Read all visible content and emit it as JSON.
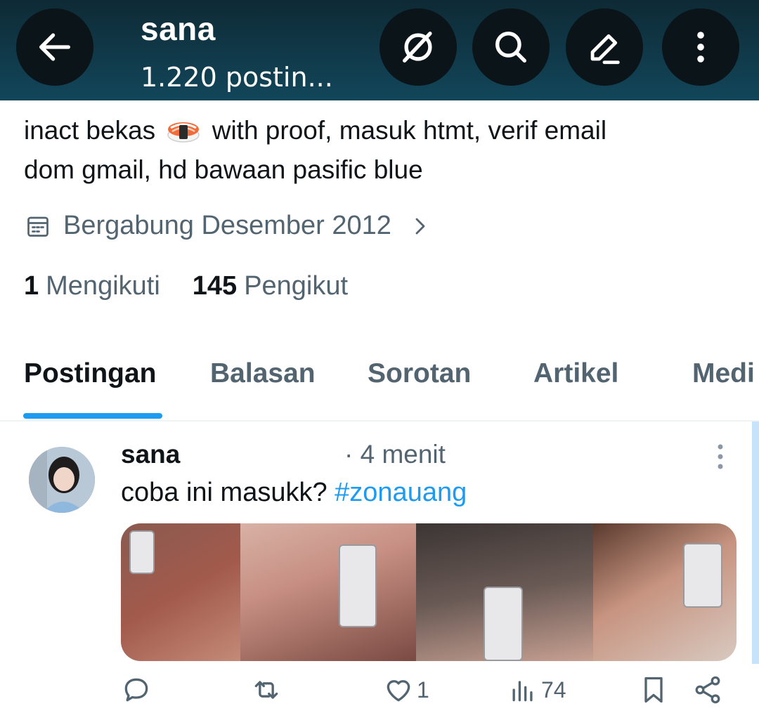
{
  "header": {
    "name": "sana",
    "post_count": "1.220 postin..."
  },
  "bio": {
    "line1_before": "inact bekas",
    "line1_after": "with proof, masuk htmt, verif email",
    "line2": "dom gmail, hd bawaan pasific blue"
  },
  "joined": "Bergabung Desember 2012",
  "follow": {
    "following_count": "1",
    "following_label": "Mengikuti",
    "followers_count": "145",
    "followers_label": "Pengikut"
  },
  "tabs": [
    {
      "label": "Postingan",
      "active": true
    },
    {
      "label": "Balasan",
      "active": false
    },
    {
      "label": "Sorotan",
      "active": false
    },
    {
      "label": "Artikel",
      "active": false
    },
    {
      "label": "Medi",
      "active": false
    }
  ],
  "post": {
    "author": "sana",
    "time": "· 4 menit",
    "text": "coba ini masukk?",
    "hashtag": "#zonauang",
    "likes": "1",
    "views": "74"
  },
  "colors": {
    "accent": "#1d9bf0",
    "header_bg": "#12465a",
    "muted_text": "#536471"
  }
}
